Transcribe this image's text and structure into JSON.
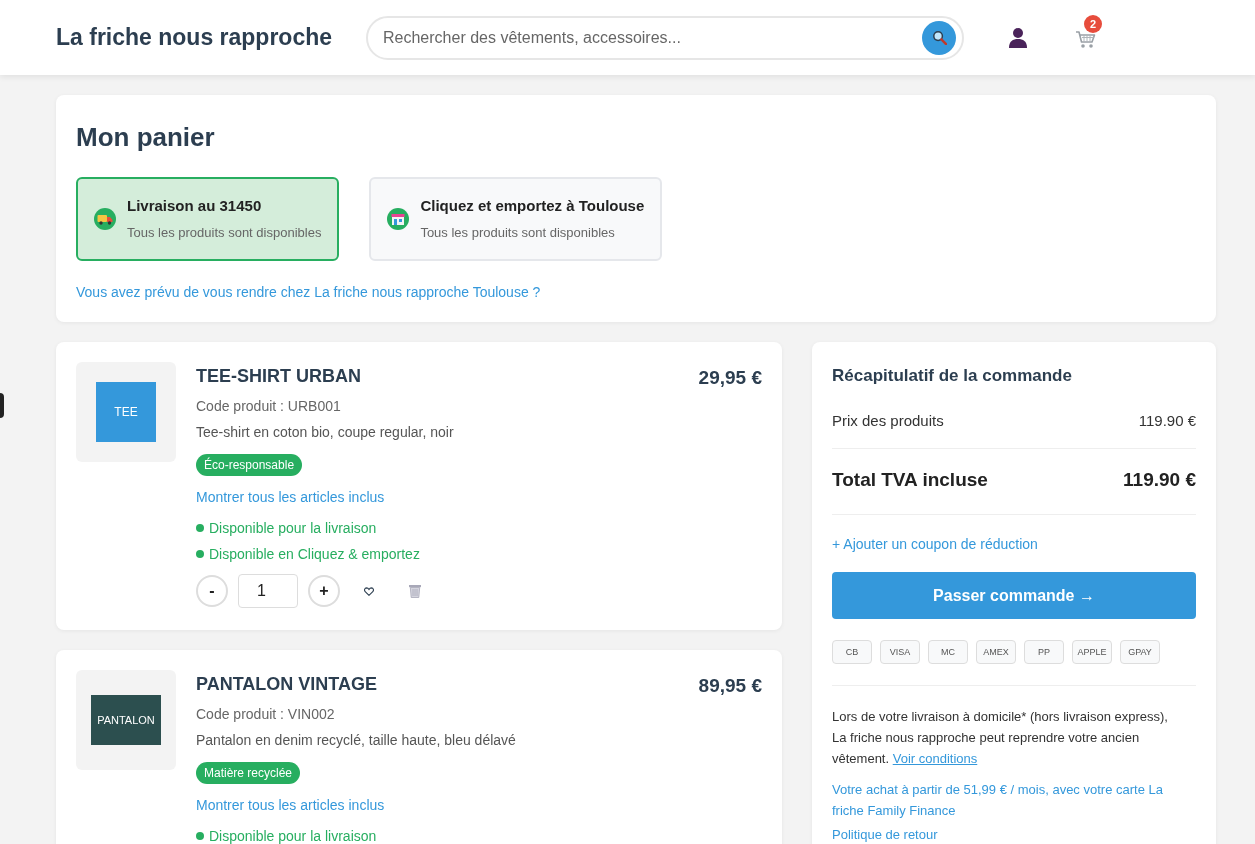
{
  "header": {
    "logo": "La friche nous rapproche",
    "search": {
      "placeholder": "Rechercher des vêtements, accessoires..."
    },
    "cart_count": "2"
  },
  "cart": {
    "title": "Mon panier",
    "delivery_options": [
      {
        "kind": "delivery",
        "title": "Livraison au 31450",
        "subtitle": "Tous les produits sont disponibles",
        "selected": true
      },
      {
        "kind": "pickup",
        "title": "Cliquez et emportez à Toulouse",
        "subtitle": "Tous les produits sont disponibles",
        "selected": false
      }
    ],
    "store_link": "Vous avez prévu de vous rendre chez La friche nous rapproche Toulouse ?"
  },
  "products": [
    {
      "name": "TEE-SHIRT URBAN",
      "price": "29,95 €",
      "code": "Code produit : URB001",
      "description": "Tee-shirt en coton bio, coupe regular, noir",
      "badge": "Éco-responsable",
      "thumbnail": {
        "label": "TEE",
        "color": "#3498db"
      },
      "details_link": "Montrer tous les articles inclus",
      "availability": [
        "Disponible pour la livraison",
        "Disponible en Cliquez & emportez"
      ],
      "quantity": {
        "decrease": "-",
        "value": "1",
        "increase": "+"
      }
    },
    {
      "name": "PANTALON VINTAGE",
      "price": "89,95 €",
      "code": "Code produit : VIN002",
      "description": "Pantalon en denim recyclé, taille haute, bleu délavé",
      "badge": "Matière recyclée",
      "thumbnail": {
        "label": "PANTALON",
        "color": "#2c4f4f"
      },
      "details_link": "Montrer tous les articles inclus",
      "availability": [
        "Disponible pour la livraison"
      ]
    }
  ],
  "summary": {
    "title": "Récapitulatif de la commande",
    "subtotal": {
      "label": "Prix des produits",
      "value": "119.90 €"
    },
    "total": {
      "label": "Total TVA incluse",
      "value": "119.90 €"
    },
    "coupon_link": "+ Ajouter un coupon de réduction",
    "checkout_button": "Passer commande →",
    "payment_methods": [
      "CB",
      "VISA",
      "MC",
      "AMEX",
      "PP",
      "APPLE",
      "GPAY"
    ],
    "takeback_text": "Lors de votre livraison à domicile* (hors livraison express), La friche nous rapproche peut reprendre votre ancien vêtement.",
    "takeback_link": "Voir conditions",
    "financing_text": "Votre achat à partir de 51,99 € / mois, avec votre carte La friche Family Finance",
    "return_policy_link": "Politique de retour"
  }
}
